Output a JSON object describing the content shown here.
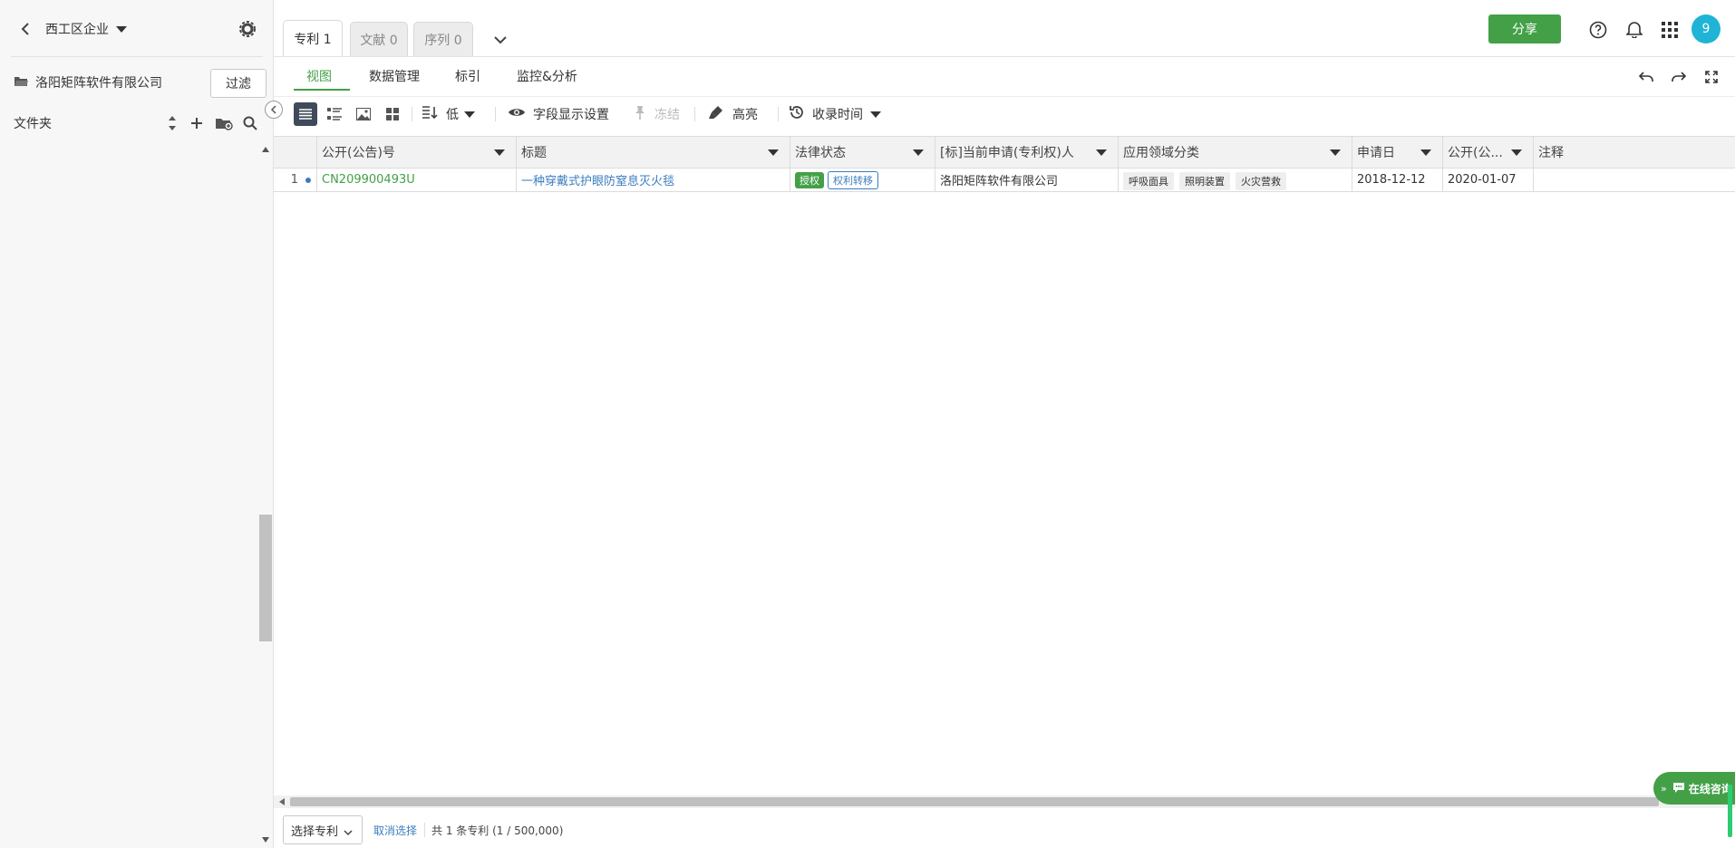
{
  "colors": {
    "accent": "#43a047",
    "link": "#3b7dbf",
    "avatar": "#1fb4d6"
  },
  "sidebar": {
    "group_name": "西工区企业",
    "org_name": "洛阳矩阵软件有限公司",
    "filter_label": "过滤",
    "folder_label": "文件夹"
  },
  "tabs": [
    {
      "label": "专利 1"
    },
    {
      "label": "文献 0"
    },
    {
      "label": "序列 0"
    }
  ],
  "header": {
    "share_label": "分享",
    "avatar_text": "9"
  },
  "subtabs": [
    {
      "label": "视图"
    },
    {
      "label": "数据管理"
    },
    {
      "label": "标引"
    },
    {
      "label": "监控&分析"
    }
  ],
  "toolbar": {
    "density_label": "低",
    "field_settings_label": "字段显示设置",
    "freeze_label": "冻结",
    "highlight_label": "高亮",
    "collect_time_label": "收录时间"
  },
  "table": {
    "columns": [
      "公开(公告)号",
      "标题",
      "法律状态",
      "[标]当前申请(专利权)人",
      "应用领域分类",
      "申请日",
      "公开(公...",
      "注释"
    ],
    "rows": [
      {
        "index": "1",
        "pub_no": "CN209900493U",
        "title": "一种穿戴式护眼防窒息灭火毯",
        "status_1": "授权",
        "status_2": "权利转移",
        "applicant": "洛阳矩阵软件有限公司",
        "tags": [
          "呼吸面具",
          "照明装置",
          "火灾营救"
        ],
        "apply_date": "2018-12-12",
        "pub_date": "2020-01-07",
        "note": ""
      }
    ]
  },
  "footer": {
    "select_label": "选择专利",
    "cancel_label": "取消选择",
    "count_text": "共 1 条专利 (1 / 500,000)"
  },
  "chat_widget": {
    "label": "在线咨询"
  }
}
